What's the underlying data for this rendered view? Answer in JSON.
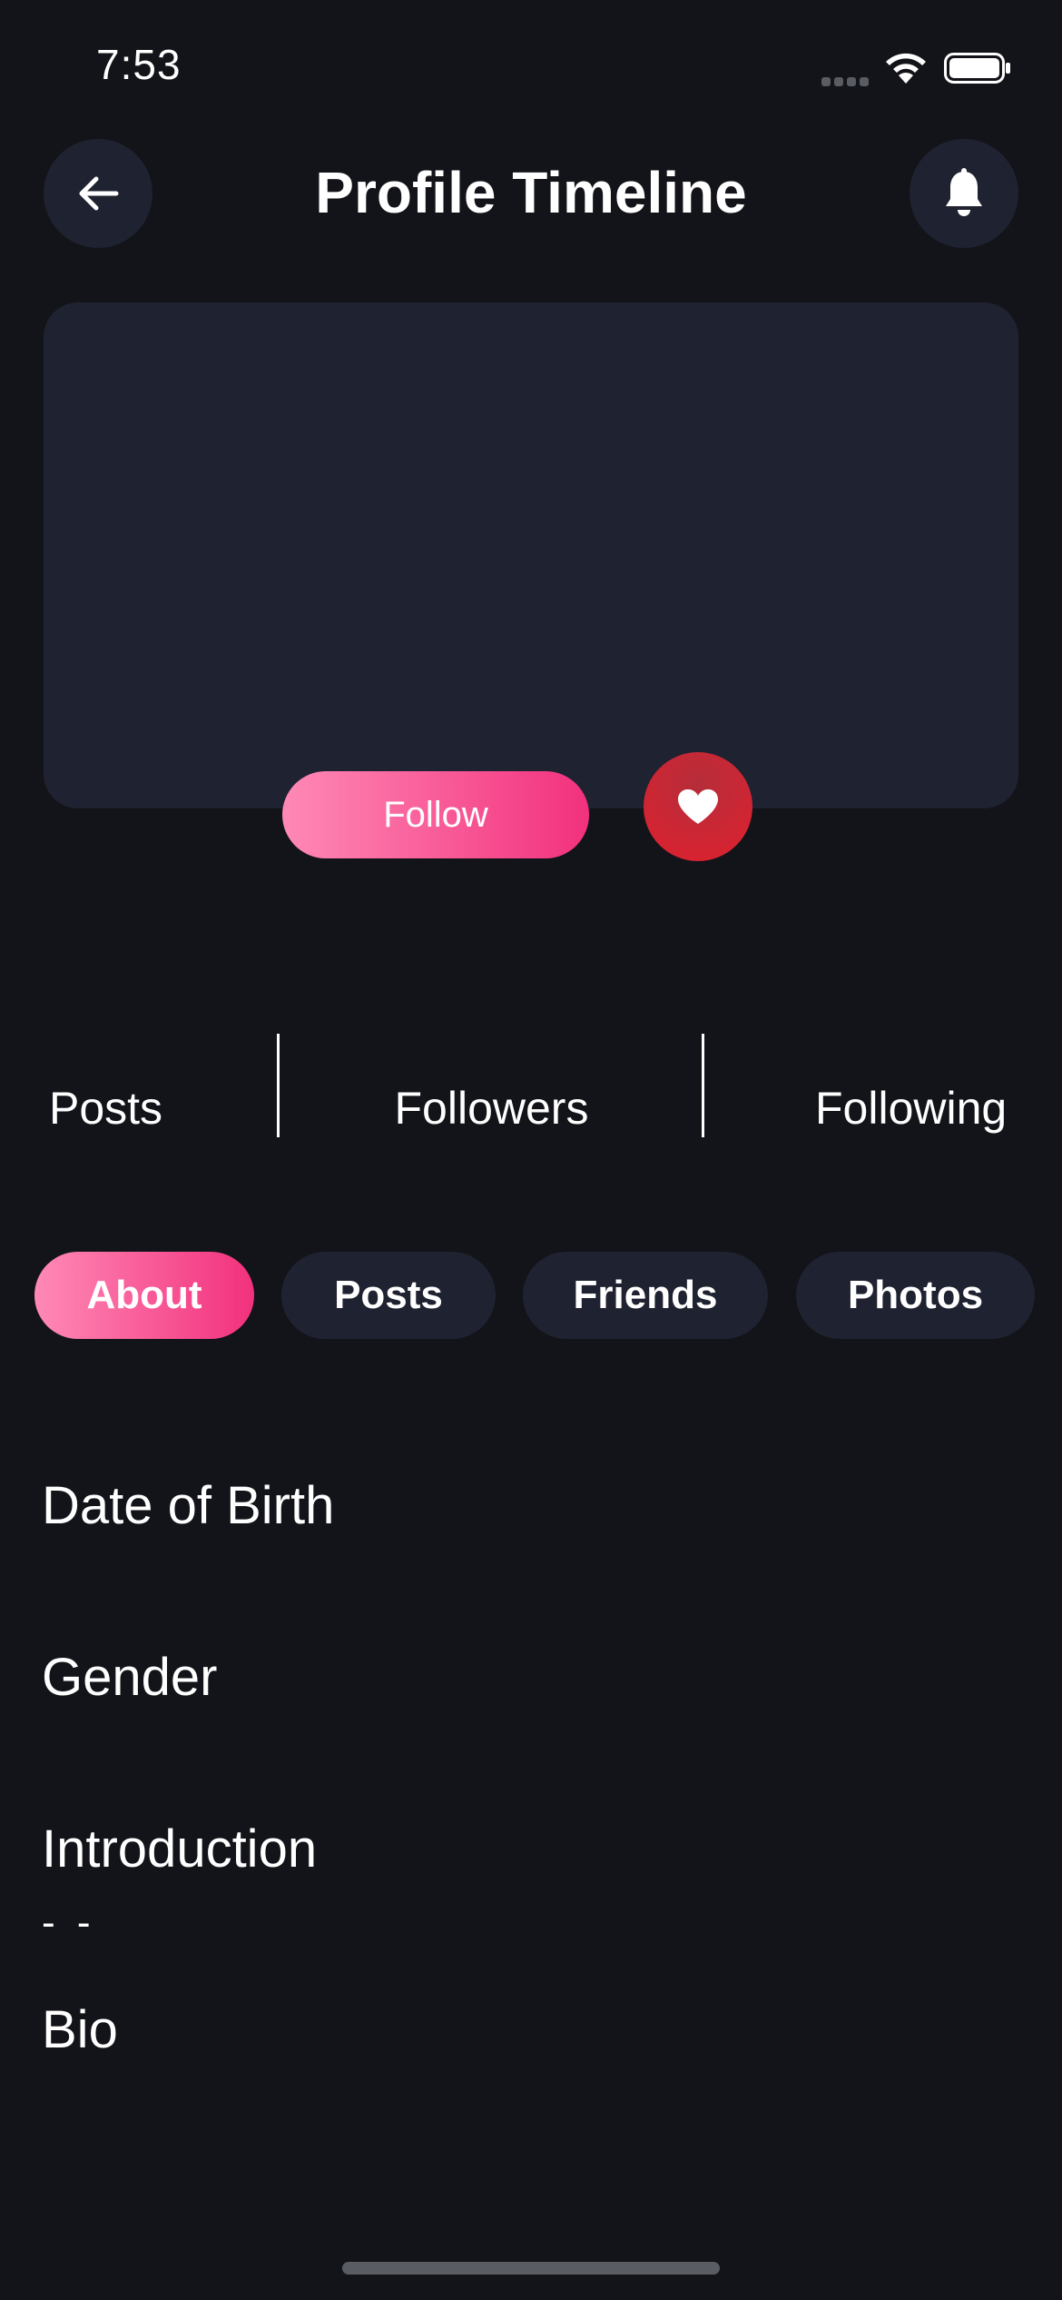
{
  "status_bar": {
    "time": "7:53"
  },
  "header": {
    "title": "Profile Timeline",
    "back_icon": "arrow-left-icon",
    "notification_icon": "bell-icon"
  },
  "profile": {
    "follow_label": "Follow",
    "like_icon": "heart-icon"
  },
  "stats": {
    "posts_label": "Posts",
    "followers_label": "Followers",
    "following_label": "Following"
  },
  "tabs": [
    {
      "label": "About",
      "active": true
    },
    {
      "label": "Posts",
      "active": false
    },
    {
      "label": "Friends",
      "active": false
    },
    {
      "label": "Photos",
      "active": false
    }
  ],
  "about": {
    "date_of_birth_label": "Date of Birth",
    "gender_label": "Gender",
    "introduction_label": "Introduction",
    "introduction_value": "- -",
    "bio_label": "Bio"
  },
  "colors": {
    "background": "#131419",
    "card": "#1f2230",
    "accent_start": "#ff89b6",
    "accent_end": "#f2317d",
    "heart": "#e0202e"
  }
}
